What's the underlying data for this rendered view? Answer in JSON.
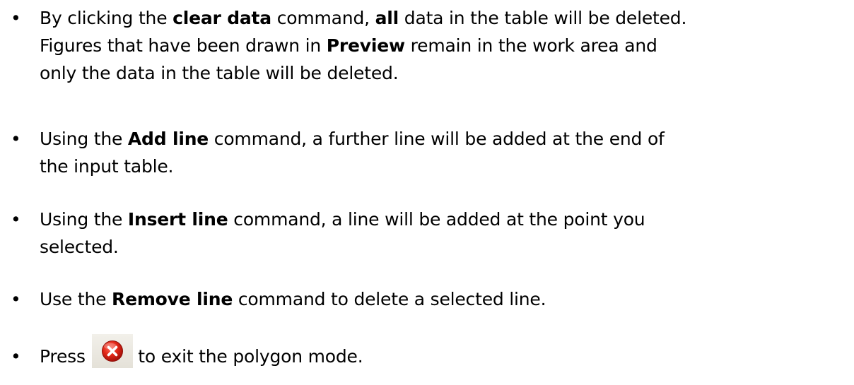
{
  "bullet_char": "•",
  "items": [
    {
      "p1": "By clicking the ",
      "b1": "clear data",
      "p2": " command, ",
      "b2": "all",
      "p3": " data in the table will be deleted.",
      "p4": "Figures that have been drawn in ",
      "b3": "Preview",
      "p5": " remain in the work area and",
      "p6": "only the data in the table will be deleted."
    },
    {
      "p1": "Using the ",
      "b1": "Add line",
      "p2": " command, a further line will be added at the end of",
      "p3": "the input table."
    },
    {
      "p1": "Using the ",
      "b1": "Insert line",
      "p2": " command, a line will be added at the point you",
      "p3": "selected."
    },
    {
      "p1": "Use the ",
      "b1": "Remove line",
      "p2": " command to delete a selected line."
    },
    {
      "p1": "Press ",
      "icon": "close-x-circle-icon",
      "p2": " to exit the polygon mode."
    }
  ]
}
